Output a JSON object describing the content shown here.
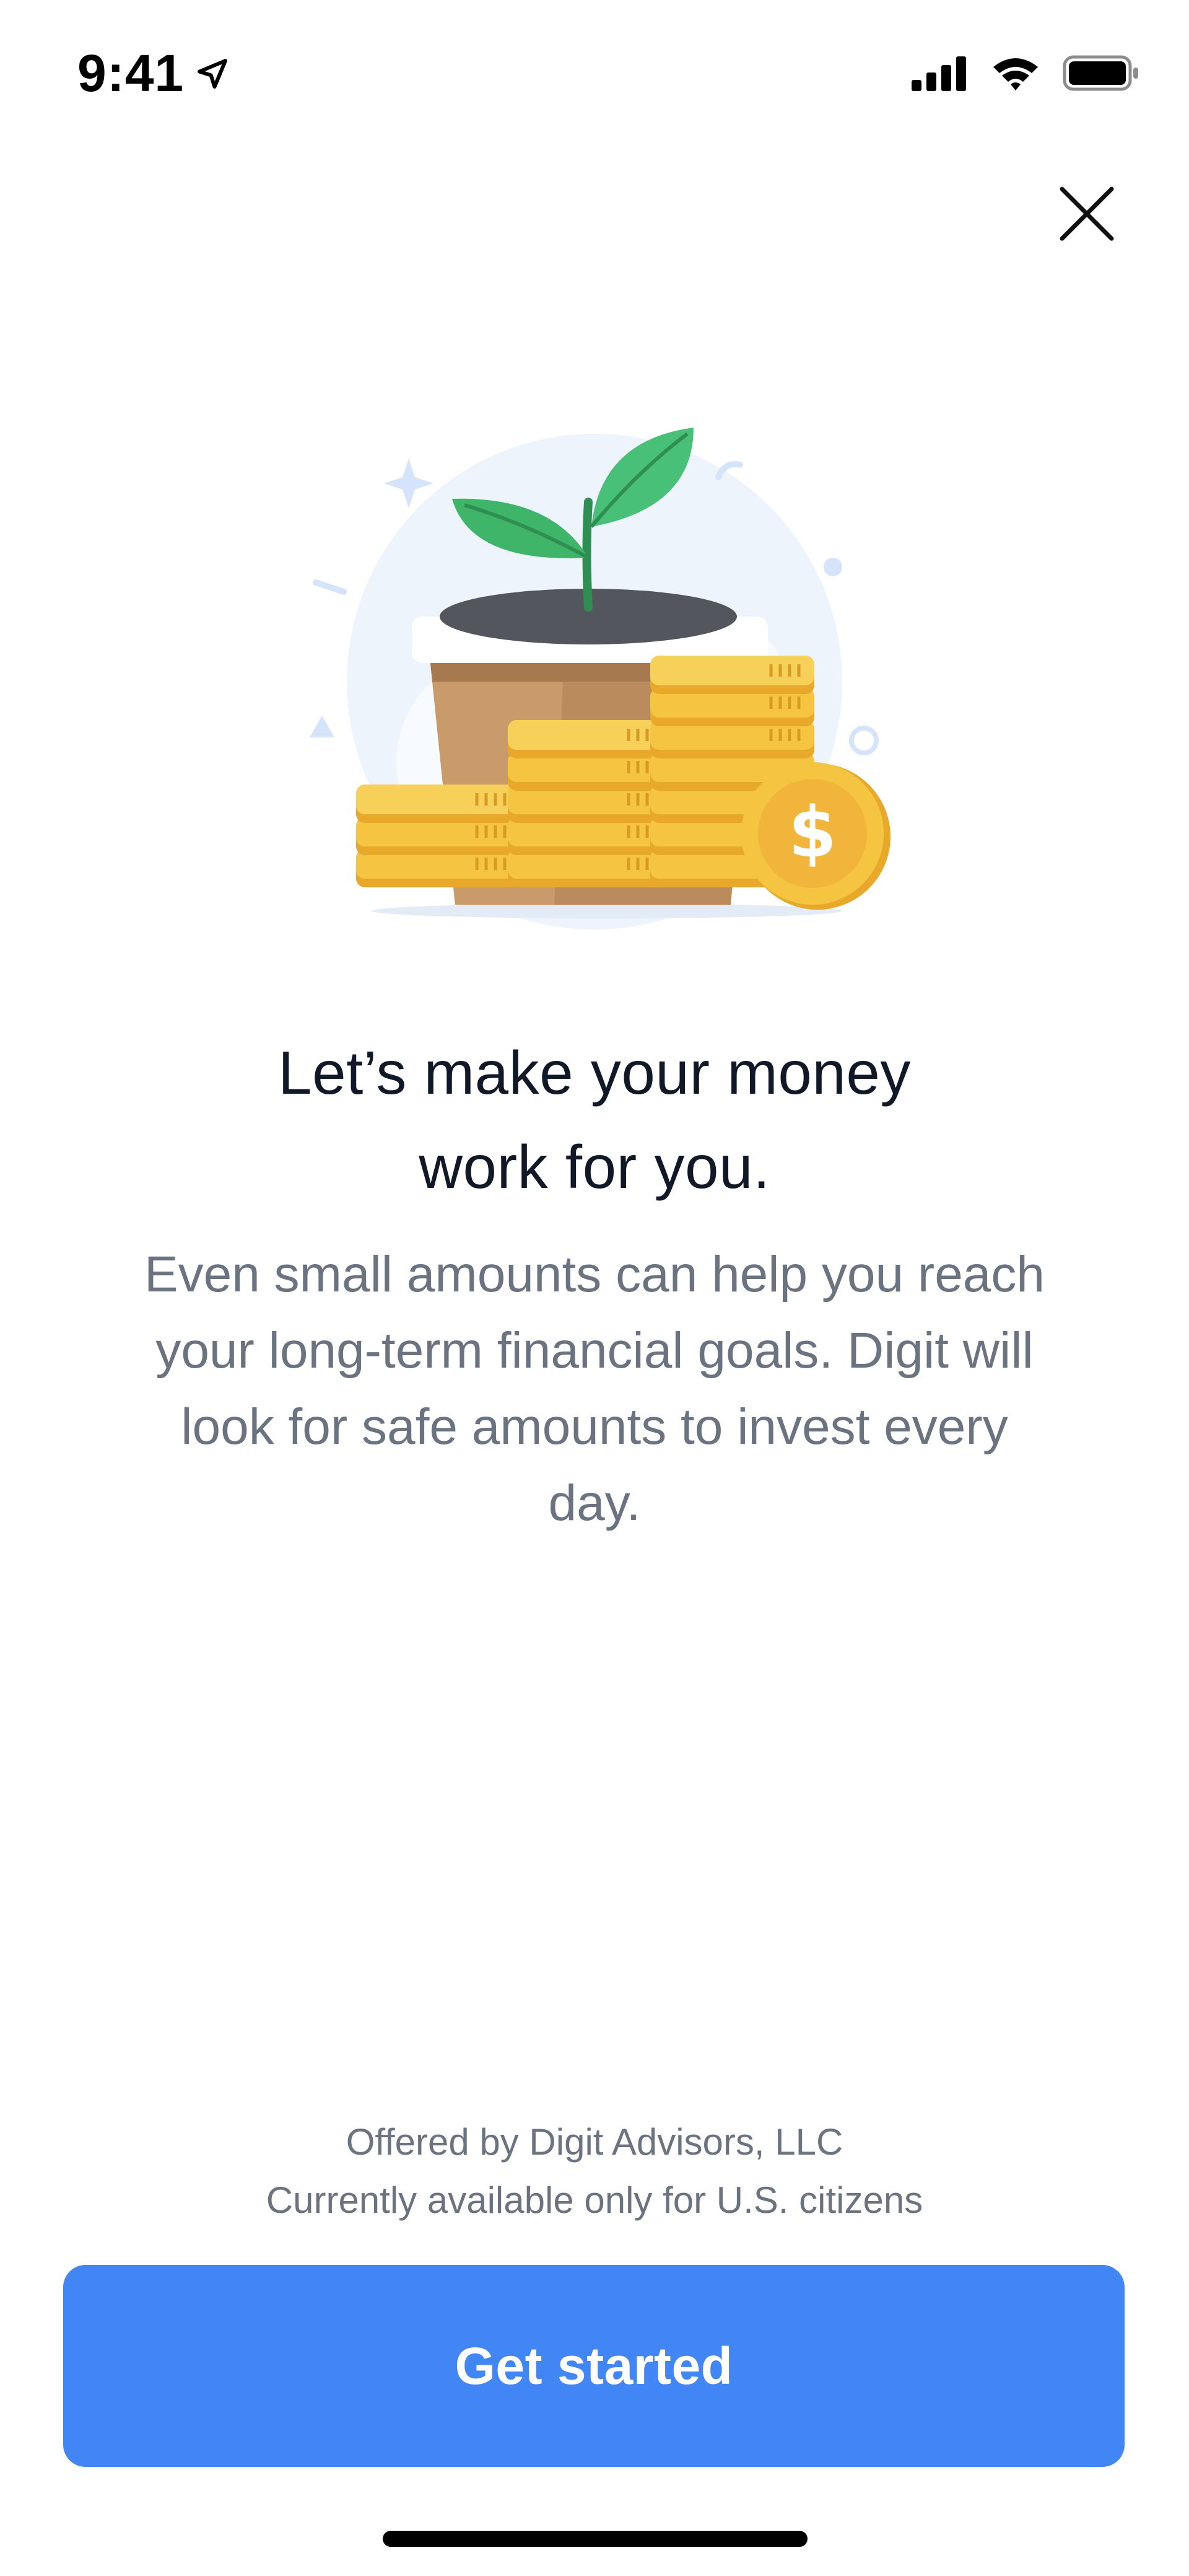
{
  "status_bar": {
    "time": "9:41",
    "icons": [
      "location-arrow-icon",
      "cellular-signal-icon",
      "wifi-icon",
      "battery-icon"
    ]
  },
  "close": {
    "icon": "close-icon"
  },
  "hero": {
    "description": "plant-growing-from-pot-with-coin-stacks-illustration",
    "coin_symbol": "$"
  },
  "content": {
    "title_line1": "Let’s make your money",
    "title_line2": "work for you.",
    "body_line1": "Even small amounts can help you reach",
    "body_line2": "your long-term financial goals. Digit will",
    "body_line3": "look for safe amounts to invest every",
    "body_line4": "day."
  },
  "disclaimer": {
    "line1": "Offered by Digit Advisors, LLC",
    "line2": "Currently available only for U.S. citizens"
  },
  "cta": {
    "label": "Get started"
  },
  "colors": {
    "accent": "#4285f4",
    "title": "#111827",
    "muted": "#6b7280",
    "coin": "#f5c542",
    "leaf": "#3fb56a"
  }
}
